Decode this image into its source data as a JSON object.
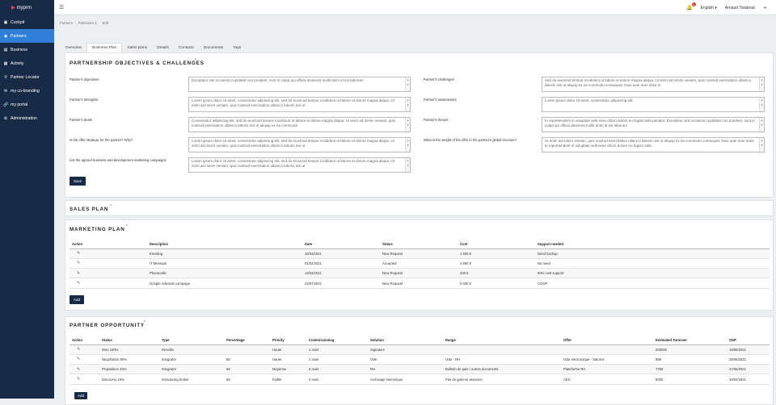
{
  "app": {
    "logo": "myprm"
  },
  "sidebar": {
    "items": [
      {
        "label": "Cockpit",
        "icon": "dashboard-icon",
        "active": false
      },
      {
        "label": "Partners",
        "icon": "partners-icon",
        "active": true
      },
      {
        "label": "Business",
        "icon": "briefcase-icon",
        "active": false
      },
      {
        "label": "Activity",
        "icon": "calendar-icon",
        "active": false
      },
      {
        "label": "Partner Locator",
        "icon": "map-pin-icon",
        "active": false
      },
      {
        "label": "my co-branding",
        "icon": "envelope-icon",
        "active": false
      },
      {
        "label": "my portal",
        "icon": "link-icon",
        "active": false
      },
      {
        "label": "Administration",
        "icon": "gears-icon",
        "active": false
      }
    ]
  },
  "topbar": {
    "notification_count": "1",
    "language": "English",
    "user": "Arnaud Tarabout"
  },
  "breadcrumb": [
    "Partners",
    "Partenaire 2",
    "Edit"
  ],
  "tabs": [
    "Overview",
    "Business Plan",
    "Sales plans",
    "Details",
    "Contacts",
    "Documents",
    "Tags"
  ],
  "active_tab": "Business Plan",
  "objectives": {
    "title": "PARTNERSHIP OBJECTIVES & CHALLENGES",
    "left": [
      {
        "label": "Partner's objectives",
        "value": "Excepteur sint occaecat cupidatat non proident, sunt in culpa qui officia deserunt mollit anim id est laborum"
      },
      {
        "label": "Partner's strengths",
        "value": "Lorem ipsum dolor sit amet, consectetur adipiscing elit, sed do eiusmod tempor incididunt ut labore et dolore magna aliqua. Ut enim ad minim veniam, quis nostrud exercitation ullamco laboris nisi ut"
      },
      {
        "label": "Partner's deals",
        "value": "Consectetur adipiscing elit, sed do eiusmod tempor incididunt ut labore et dolore magna aliqua. Ut enim ad minim veniam, quis nostrud exercitation ullamco laboris nisi ut aliquip ex ea commodo"
      },
      {
        "label": "Is the offer strategic for the partner? Why?",
        "value": "Lorem ipsum dolor sit amet, consectetur adipiscing elit, sed do eiusmod tempor incididunt ut labore et dolore magna aliqua. Ut enim ad minim veniam, quis nostrud exercitation ullamco laboris nisi ut"
      },
      {
        "label": "List the agreed business and development marketing campaigns",
        "value": "Lorem ipsum dolor sit amet, consectetur adipiscing elit, sed do eiusmod tempor incididunt ut labore et dolore magna aliqua. Ut enim ad minim veniam, quis nostrud exercitation ullamco laboris nisi ut"
      }
    ],
    "right": [
      {
        "label": "Partner's challenges",
        "value": "Sed do eiusmod tempor incididunt ut labore et dolore magna aliqua. Ut enim ad minim veniam, quis nostrud exercitation ullamco laboris nisi ut aliquip ex ea commodo consequat. Duis aute irure dolor in"
      },
      {
        "label": "Partner's weaknesses",
        "value": "Lorem ipsum dolor sit amet, consectetur adipiscing elit."
      },
      {
        "label": "Partner's threats",
        "value": "In reprehenderit in voluptate velit esse cillum dolore eu fugiat nulla pariatur. Excepteur sint occaecat cupidatat non proident, sunt in culpa qui officia deserunt mollit anim id est laborum"
      },
      {
        "label": "What is the weight of the offer in the partner's global revenue?",
        "value": "Ut enim ad minim veniam, quis nostrud exercitation ullamco laboris nisi ut aliquip ex ea commodo consequat. Duis aute irure dolor in reprehenderit in voluptate velit esse cillum dolore eu fugiat nulla"
      }
    ],
    "save_label": "Save"
  },
  "sales_plan": {
    "title": "SALES PLAN"
  },
  "marketing_plan": {
    "title": "MARKETING PLAN",
    "columns": [
      "Action",
      "Description",
      "Date",
      "Status",
      "Cost",
      "Support needed"
    ],
    "rows": [
      [
        "Emailing",
        "16/03/2021",
        "New Request",
        "1 500 €",
        "Need backup"
      ],
      [
        "IT Meetups",
        "01/04/2021",
        "Accepted",
        "4 500 €",
        "No need"
      ],
      [
        "Phonecalls",
        "14/03/2021",
        "New Request",
        "200 €",
        "50% cost support"
      ],
      [
        "Google Adwords campaign",
        "22/07/2021",
        "New Request",
        "5 000 €",
        "COOP"
      ]
    ],
    "add_label": "Add"
  },
  "partner_opportunity": {
    "title": "PARTNER OPPORTUNITY",
    "columns": [
      "Action",
      "Status",
      "Type",
      "Percentage",
      "Priority",
      "Commissioning",
      "Solution",
      "Range",
      "Offer",
      "Estimated Turnover",
      "SOP"
    ],
    "rows": [
      [
        "Won 100%",
        "Reseller",
        "",
        "Haute",
        "1 mois",
        "Signature",
        "",
        "",
        "200000",
        "19/08/2021"
      ],
      [
        "Negotiation 80%",
        "Integrator",
        "88",
        "Haute",
        "1 mois",
        "Vote",
        "Vote - RH",
        "Vote electronique - Saturne",
        "888",
        "28/05/2021"
      ],
      [
        "Proposition 40%",
        "Integrator",
        "66",
        "Moyenne",
        "6 mois",
        "RH",
        "Bulletin de paie / autres documents",
        "Plateforme RH",
        "7760",
        "27/05/2021"
      ],
      [
        "Discovery 10%",
        "Introducing broker",
        "55",
        "Faible",
        "3 mois",
        "Archivage Numerique",
        "Pas de gamme associee",
        "AES",
        "5000",
        "28/04/2021"
      ]
    ],
    "add_label": "Add"
  }
}
